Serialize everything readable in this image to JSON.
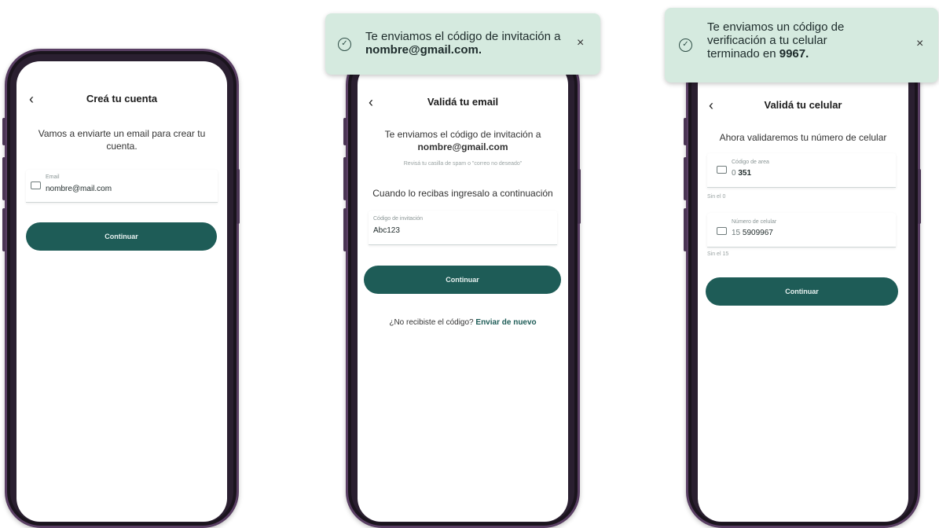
{
  "screen1": {
    "back_icon": "chevron-left-icon",
    "title": "Creá tu cuenta",
    "subtitle": "Vamos a enviarte un email para crear tu cuenta.",
    "email_field": {
      "label": "Email",
      "value": "nombre@mail.com",
      "icon": "mail-icon"
    },
    "continue_label": "Continuar"
  },
  "screen2": {
    "toast": {
      "text_prefix": "Te enviamos el código de invitación a ",
      "text_bold": "nombre@gmail.com.",
      "close": "×",
      "icon": "check-circle-icon"
    },
    "back_icon": "chevron-left-icon",
    "title": "Validá tu email",
    "subtitle_line1": "Te enviamos el código de invitación a",
    "subtitle_line2": "nombre@gmail.com",
    "hint_spam": "Revisá tu casilla de spam o \"correo no deseado\"",
    "instruction": "Cuando lo recibas ingresalo a continuación",
    "code_field": {
      "label": "Código de invitación",
      "value": "Abc123"
    },
    "continue_label": "Continuar",
    "resend_question": "¿No recibiste el código?",
    "resend_link": "Enviar de nuevo"
  },
  "screen3": {
    "toast": {
      "text_line1": "Te enviamos un código de",
      "text_line2": "verificación a tu celular",
      "text_prefix3": "terminado en ",
      "text_bold": "9967.",
      "close": "×",
      "icon": "check-circle-icon"
    },
    "back_icon": "chevron-left-icon",
    "title": "Validá tu celular",
    "subtitle": "Ahora validaremos tu número de celular",
    "area_field": {
      "label": "Código de area",
      "prefix": "0",
      "value": "351",
      "icon": "message-icon"
    },
    "area_hint": "Sin el 0",
    "phone_field": {
      "label": "Número de celular",
      "prefix": "15",
      "value": "5909967",
      "icon": "message-icon"
    },
    "phone_hint": "Sin el 15",
    "continue_label": "Continuar"
  },
  "colors": {
    "primary": "#1e5c57",
    "toast_bg": "#d5eadf",
    "frame": "#2a1f30"
  }
}
